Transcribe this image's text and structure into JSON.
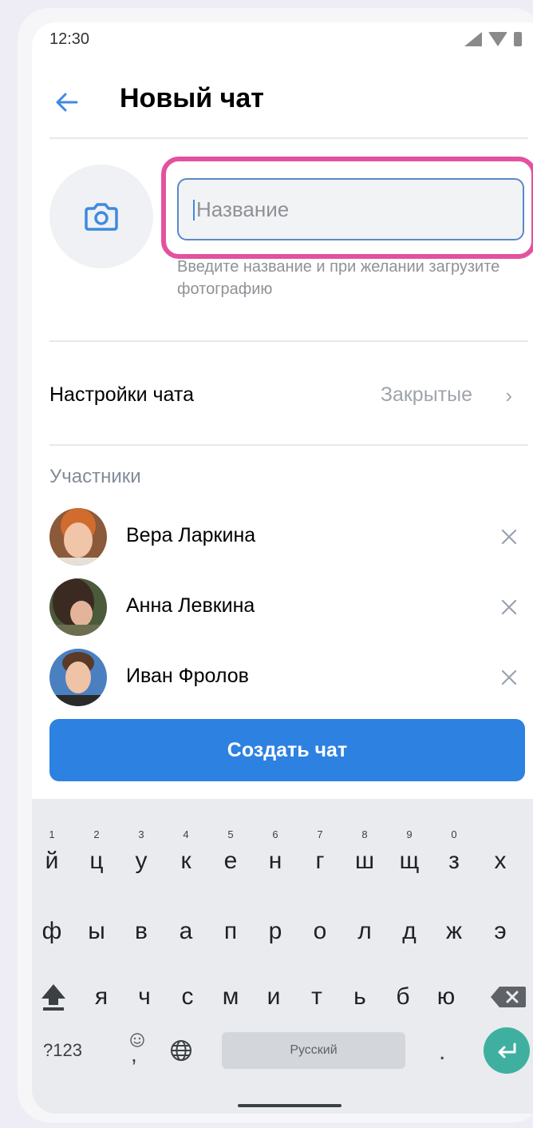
{
  "status_bar": {
    "time": "12:30"
  },
  "header": {
    "title": "Новый чат"
  },
  "chat_form": {
    "name_placeholder": "Название",
    "hint": "Введите название и при желании загрузите фотографию"
  },
  "settings": {
    "label": "Настройки чата",
    "value": "Закрытые"
  },
  "participants": {
    "title": "Участники",
    "members": [
      {
        "name": "Вера Ларкина"
      },
      {
        "name": "Анна Левкина"
      },
      {
        "name": "Иван Фролов"
      }
    ]
  },
  "create_button": {
    "label": "Создать чат"
  },
  "keyboard": {
    "row1": [
      "й",
      "ц",
      "у",
      "к",
      "е",
      "н",
      "г",
      "ш",
      "щ",
      "з",
      "х"
    ],
    "row1_numbers": [
      "1",
      "2",
      "3",
      "4",
      "5",
      "6",
      "7",
      "8",
      "9",
      "0",
      ""
    ],
    "row2": [
      "ф",
      "ы",
      "в",
      "а",
      "п",
      "р",
      "о",
      "л",
      "д",
      "ж",
      "э"
    ],
    "row3": [
      "я",
      "ч",
      "с",
      "м",
      "и",
      "т",
      "ь",
      "б",
      "ю"
    ],
    "bottom": {
      "symbols": "?123",
      "comma": ",",
      "space": "Русский",
      "period": "."
    }
  },
  "colors": {
    "accent": "#2d81e0",
    "highlight": "#e3519f",
    "enter": "#3fb09f"
  }
}
